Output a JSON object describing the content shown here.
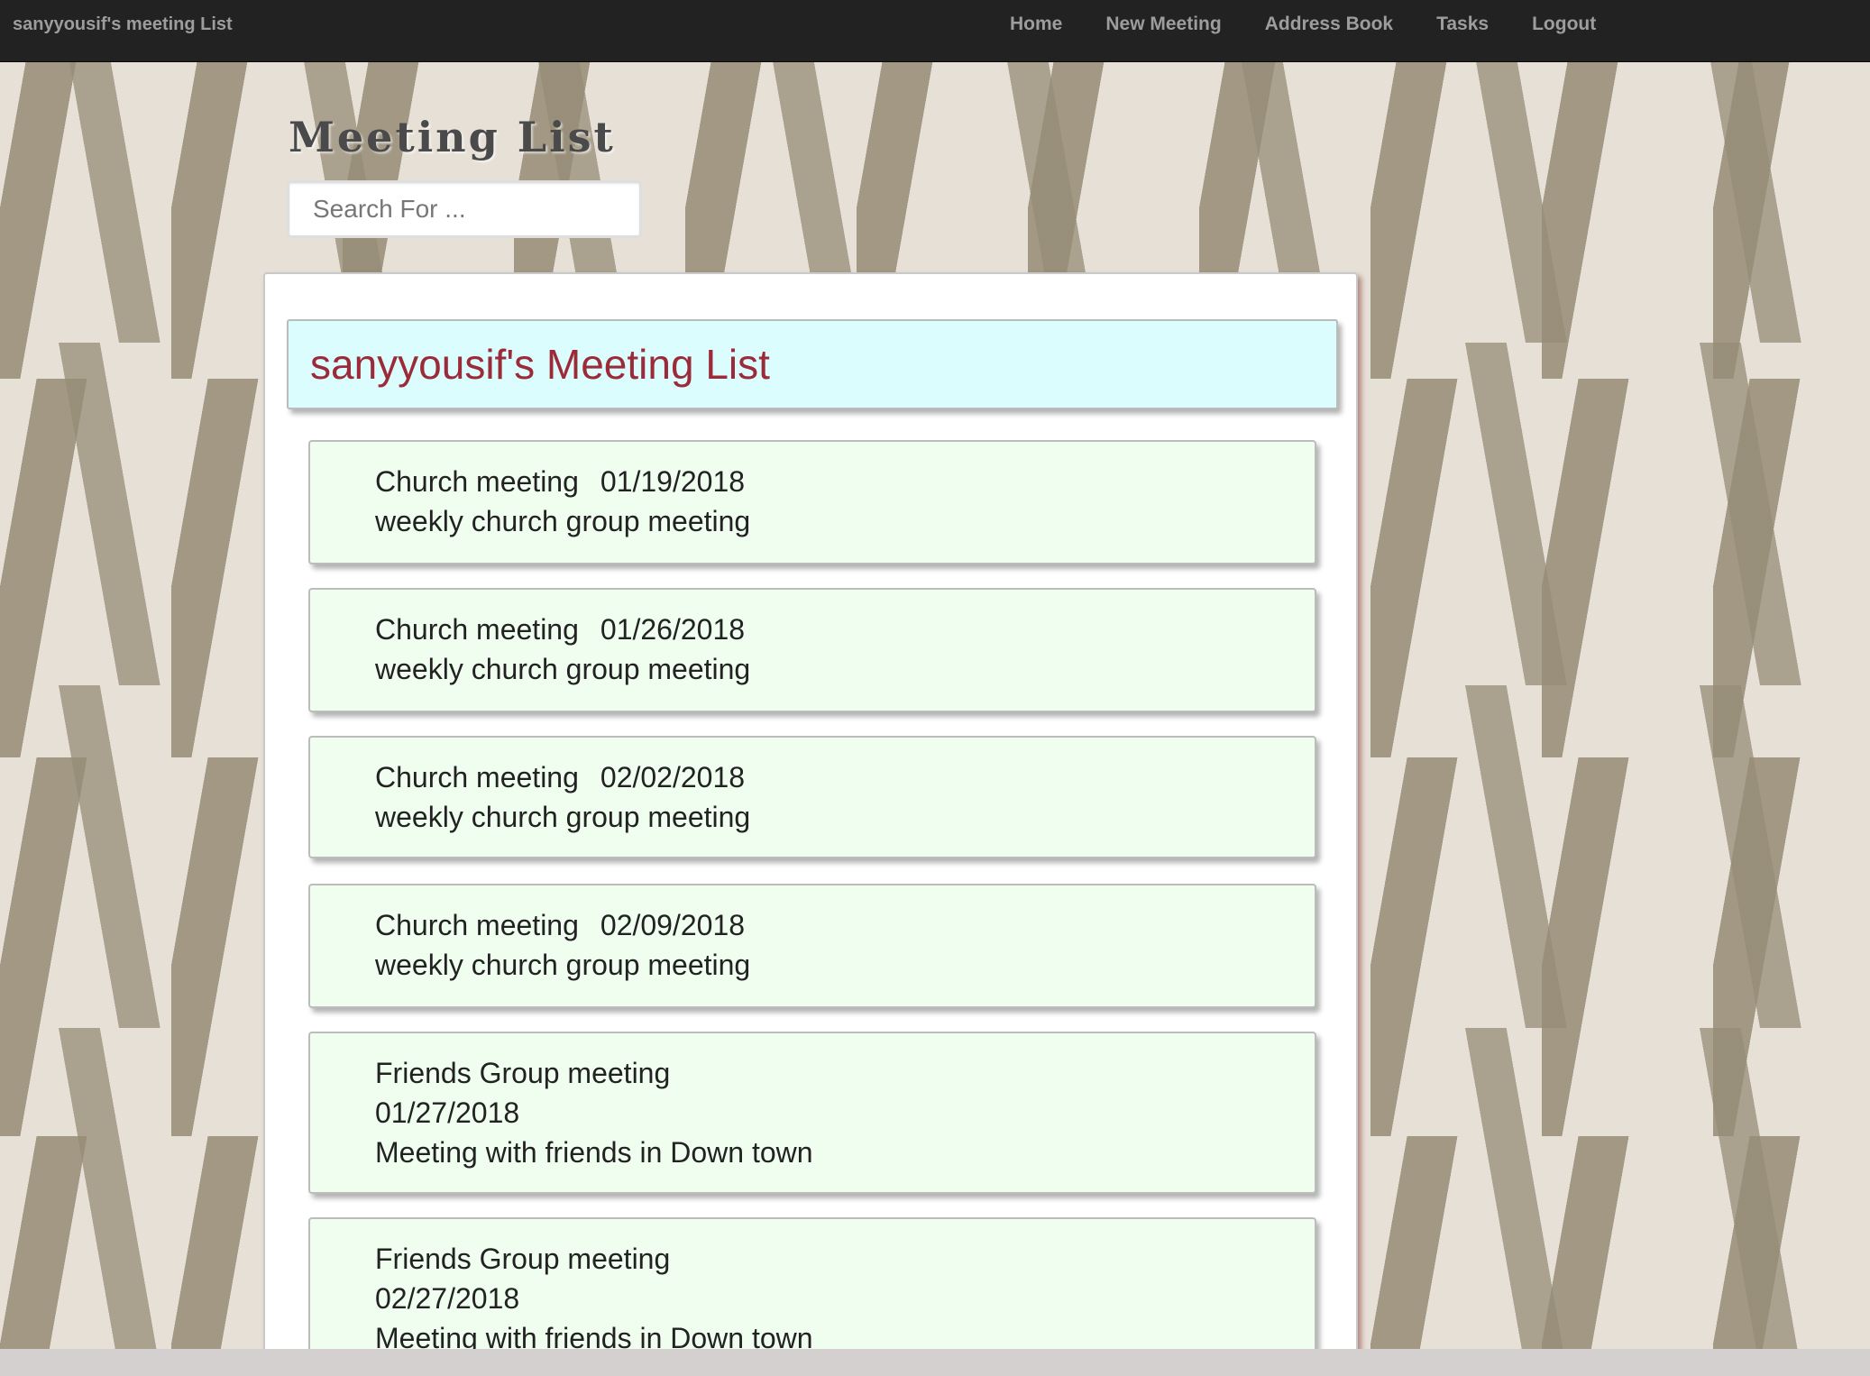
{
  "navbar": {
    "brand": "sanyyousif's meeting List",
    "links": [
      "Home",
      "New Meeting",
      "Address Book",
      "Tasks",
      "Logout"
    ]
  },
  "page": {
    "title": "Meeting List",
    "search_placeholder": "Search For ..."
  },
  "list": {
    "header": "sanyyousif's Meeting List",
    "meetings": [
      {
        "title": "Church meeting",
        "date": "01/19/2018",
        "description": "weekly church group meeting"
      },
      {
        "title": "Church meeting",
        "date": "01/26/2018",
        "description": "weekly church group meeting"
      },
      {
        "title": "Church meeting",
        "date": "02/02/2018",
        "description": "weekly church group meeting"
      },
      {
        "title": "Church meeting",
        "date": "02/09/2018",
        "description": "weekly church group meeting"
      },
      {
        "title": "Friends Group meeting",
        "date": "01/27/2018",
        "description": "Meeting with friends in Down town"
      },
      {
        "title": "Friends Group meeting",
        "date": "02/27/2018",
        "description": "Meeting with friends in Down town"
      }
    ]
  }
}
